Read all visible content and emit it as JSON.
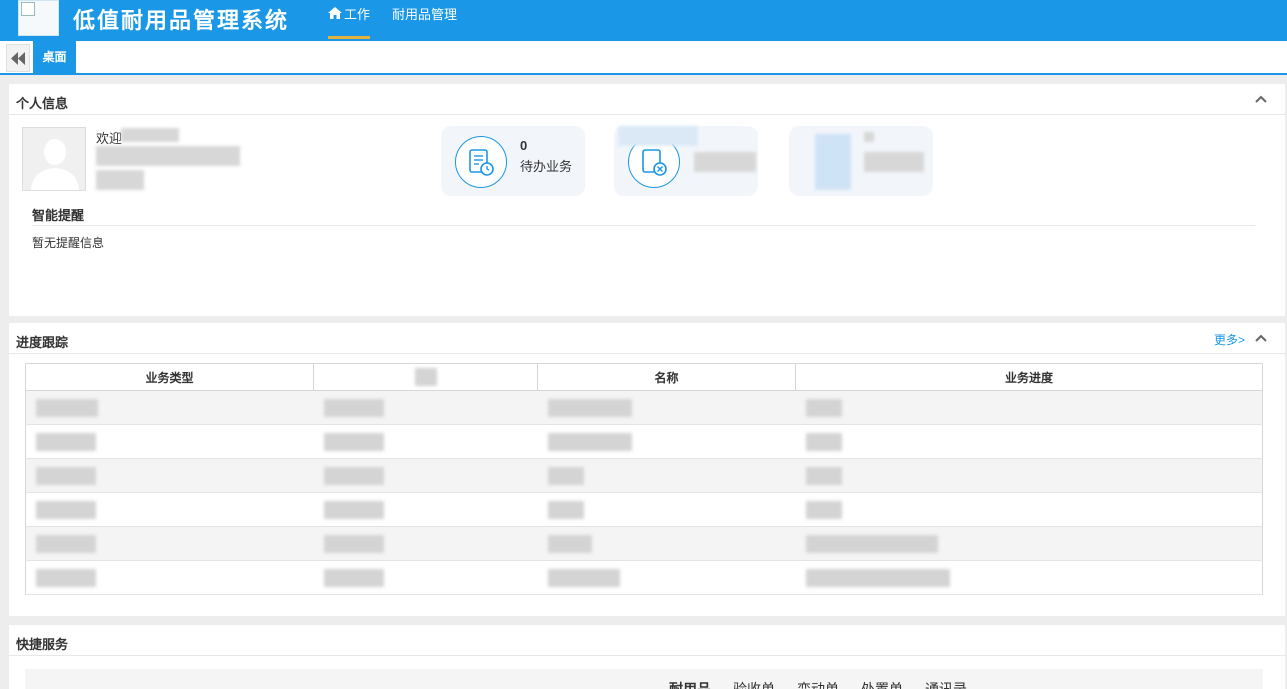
{
  "header": {
    "logo_icon": "broken-image-icon",
    "title": "低值耐用品管理系统",
    "nav": [
      {
        "label": "工作",
        "icon": "home-icon",
        "active": true
      },
      {
        "label": "耐用品管理",
        "active": false
      }
    ]
  },
  "tabbar": {
    "back_icon": "double-left-arrow-icon",
    "tabs": [
      {
        "label": "桌面",
        "active": true
      }
    ]
  },
  "personal": {
    "title": "个人信息",
    "welcome": "欢迎",
    "stats": [
      {
        "count": "0",
        "label": "待办业务",
        "icon": "document-clock-icon"
      },
      {
        "icon": "document-cancel-icon"
      },
      {
        "icon": "user-icon"
      }
    ],
    "remind": {
      "title": "智能提醒",
      "text": "暂无提醒信息"
    }
  },
  "progress": {
    "title": "进度跟踪",
    "more": "更多>",
    "columns": [
      "业务类型",
      "",
      "名称",
      "业务进度"
    ]
  },
  "quick": {
    "title": "快捷服务",
    "tabs": [
      "耐用品",
      "验收单",
      "变动单",
      "处置单",
      "通讯录"
    ]
  },
  "colors": {
    "primary": "#1a97e6",
    "accent": "#e3b23c"
  }
}
